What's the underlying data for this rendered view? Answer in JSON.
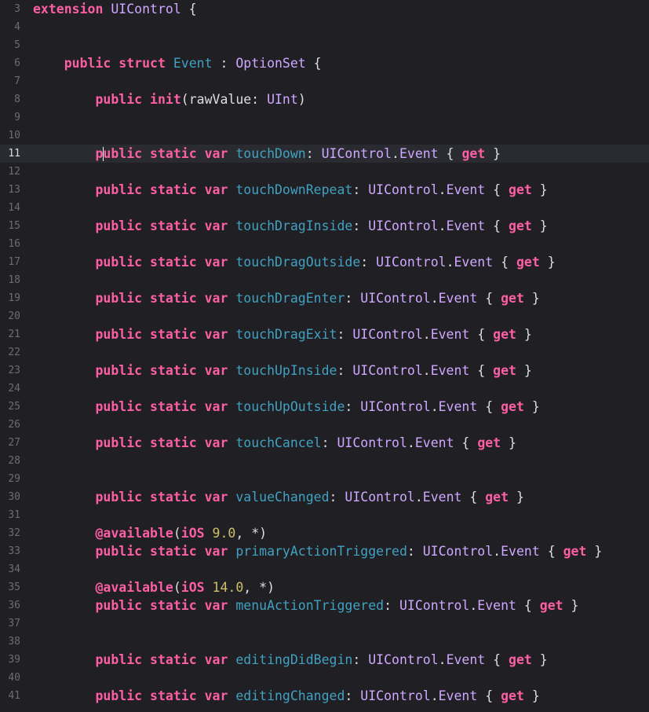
{
  "editor": {
    "colors": {
      "background": "#1f1f24",
      "current_line": "#2a2b31",
      "keyword": "#fc5fa3",
      "type": "#d0a8ff",
      "declaration": "#41a1c0",
      "number": "#d0bf69",
      "plain": "#dfdfe0",
      "line_number": "#6c6c73"
    },
    "current_line": 11,
    "lines": [
      {
        "n": "3",
        "tokens": [
          [
            "kw",
            "extension"
          ],
          [
            "plain",
            " "
          ],
          [
            "type",
            "UIControl"
          ],
          [
            "plain",
            " {"
          ]
        ]
      },
      {
        "n": "4",
        "tokens": []
      },
      {
        "n": "5",
        "tokens": []
      },
      {
        "n": "6",
        "tokens": [
          [
            "plain",
            "    "
          ],
          [
            "kw",
            "public"
          ],
          [
            "plain",
            " "
          ],
          [
            "kw",
            "struct"
          ],
          [
            "plain",
            " "
          ],
          [
            "decl",
            "Event"
          ],
          [
            "plain",
            " : "
          ],
          [
            "type",
            "OptionSet"
          ],
          [
            "plain",
            " {"
          ]
        ]
      },
      {
        "n": "7",
        "tokens": []
      },
      {
        "n": "8",
        "tokens": [
          [
            "plain",
            "        "
          ],
          [
            "kw",
            "public"
          ],
          [
            "plain",
            " "
          ],
          [
            "kw",
            "init"
          ],
          [
            "plain",
            "(rawValue: "
          ],
          [
            "type",
            "UInt"
          ],
          [
            "plain",
            ")"
          ]
        ]
      },
      {
        "n": "9",
        "tokens": []
      },
      {
        "n": "10",
        "tokens": []
      },
      {
        "n": "11",
        "tokens": [
          [
            "plain",
            "        "
          ],
          [
            "kw",
            "public"
          ],
          [
            "plain",
            " "
          ],
          [
            "kw",
            "static"
          ],
          [
            "plain",
            " "
          ],
          [
            "kw",
            "var"
          ],
          [
            "plain",
            " "
          ],
          [
            "decl",
            "touchDown"
          ],
          [
            "plain",
            ": "
          ],
          [
            "type",
            "UIControl"
          ],
          [
            "plain",
            "."
          ],
          [
            "type",
            "Event"
          ],
          [
            "plain",
            " { "
          ],
          [
            "kw",
            "get"
          ],
          [
            "plain",
            " }"
          ]
        ]
      },
      {
        "n": "12",
        "tokens": []
      },
      {
        "n": "13",
        "tokens": [
          [
            "plain",
            "        "
          ],
          [
            "kw",
            "public"
          ],
          [
            "plain",
            " "
          ],
          [
            "kw",
            "static"
          ],
          [
            "plain",
            " "
          ],
          [
            "kw",
            "var"
          ],
          [
            "plain",
            " "
          ],
          [
            "decl",
            "touchDownRepeat"
          ],
          [
            "plain",
            ": "
          ],
          [
            "type",
            "UIControl"
          ],
          [
            "plain",
            "."
          ],
          [
            "type",
            "Event"
          ],
          [
            "plain",
            " { "
          ],
          [
            "kw",
            "get"
          ],
          [
            "plain",
            " }"
          ]
        ]
      },
      {
        "n": "14",
        "tokens": []
      },
      {
        "n": "15",
        "tokens": [
          [
            "plain",
            "        "
          ],
          [
            "kw",
            "public"
          ],
          [
            "plain",
            " "
          ],
          [
            "kw",
            "static"
          ],
          [
            "plain",
            " "
          ],
          [
            "kw",
            "var"
          ],
          [
            "plain",
            " "
          ],
          [
            "decl",
            "touchDragInside"
          ],
          [
            "plain",
            ": "
          ],
          [
            "type",
            "UIControl"
          ],
          [
            "plain",
            "."
          ],
          [
            "type",
            "Event"
          ],
          [
            "plain",
            " { "
          ],
          [
            "kw",
            "get"
          ],
          [
            "plain",
            " }"
          ]
        ]
      },
      {
        "n": "16",
        "tokens": []
      },
      {
        "n": "17",
        "tokens": [
          [
            "plain",
            "        "
          ],
          [
            "kw",
            "public"
          ],
          [
            "plain",
            " "
          ],
          [
            "kw",
            "static"
          ],
          [
            "plain",
            " "
          ],
          [
            "kw",
            "var"
          ],
          [
            "plain",
            " "
          ],
          [
            "decl",
            "touchDragOutside"
          ],
          [
            "plain",
            ": "
          ],
          [
            "type",
            "UIControl"
          ],
          [
            "plain",
            "."
          ],
          [
            "type",
            "Event"
          ],
          [
            "plain",
            " { "
          ],
          [
            "kw",
            "get"
          ],
          [
            "plain",
            " }"
          ]
        ]
      },
      {
        "n": "18",
        "tokens": []
      },
      {
        "n": "19",
        "tokens": [
          [
            "plain",
            "        "
          ],
          [
            "kw",
            "public"
          ],
          [
            "plain",
            " "
          ],
          [
            "kw",
            "static"
          ],
          [
            "plain",
            " "
          ],
          [
            "kw",
            "var"
          ],
          [
            "plain",
            " "
          ],
          [
            "decl",
            "touchDragEnter"
          ],
          [
            "plain",
            ": "
          ],
          [
            "type",
            "UIControl"
          ],
          [
            "plain",
            "."
          ],
          [
            "type",
            "Event"
          ],
          [
            "plain",
            " { "
          ],
          [
            "kw",
            "get"
          ],
          [
            "plain",
            " }"
          ]
        ]
      },
      {
        "n": "20",
        "tokens": []
      },
      {
        "n": "21",
        "tokens": [
          [
            "plain",
            "        "
          ],
          [
            "kw",
            "public"
          ],
          [
            "plain",
            " "
          ],
          [
            "kw",
            "static"
          ],
          [
            "plain",
            " "
          ],
          [
            "kw",
            "var"
          ],
          [
            "plain",
            " "
          ],
          [
            "decl",
            "touchDragExit"
          ],
          [
            "plain",
            ": "
          ],
          [
            "type",
            "UIControl"
          ],
          [
            "plain",
            "."
          ],
          [
            "type",
            "Event"
          ],
          [
            "plain",
            " { "
          ],
          [
            "kw",
            "get"
          ],
          [
            "plain",
            " }"
          ]
        ]
      },
      {
        "n": "22",
        "tokens": []
      },
      {
        "n": "23",
        "tokens": [
          [
            "plain",
            "        "
          ],
          [
            "kw",
            "public"
          ],
          [
            "plain",
            " "
          ],
          [
            "kw",
            "static"
          ],
          [
            "plain",
            " "
          ],
          [
            "kw",
            "var"
          ],
          [
            "plain",
            " "
          ],
          [
            "decl",
            "touchUpInside"
          ],
          [
            "plain",
            ": "
          ],
          [
            "type",
            "UIControl"
          ],
          [
            "plain",
            "."
          ],
          [
            "type",
            "Event"
          ],
          [
            "plain",
            " { "
          ],
          [
            "kw",
            "get"
          ],
          [
            "plain",
            " }"
          ]
        ]
      },
      {
        "n": "24",
        "tokens": []
      },
      {
        "n": "25",
        "tokens": [
          [
            "plain",
            "        "
          ],
          [
            "kw",
            "public"
          ],
          [
            "plain",
            " "
          ],
          [
            "kw",
            "static"
          ],
          [
            "plain",
            " "
          ],
          [
            "kw",
            "var"
          ],
          [
            "plain",
            " "
          ],
          [
            "decl",
            "touchUpOutside"
          ],
          [
            "plain",
            ": "
          ],
          [
            "type",
            "UIControl"
          ],
          [
            "plain",
            "."
          ],
          [
            "type",
            "Event"
          ],
          [
            "plain",
            " { "
          ],
          [
            "kw",
            "get"
          ],
          [
            "plain",
            " }"
          ]
        ]
      },
      {
        "n": "26",
        "tokens": []
      },
      {
        "n": "27",
        "tokens": [
          [
            "plain",
            "        "
          ],
          [
            "kw",
            "public"
          ],
          [
            "plain",
            " "
          ],
          [
            "kw",
            "static"
          ],
          [
            "plain",
            " "
          ],
          [
            "kw",
            "var"
          ],
          [
            "plain",
            " "
          ],
          [
            "decl",
            "touchCancel"
          ],
          [
            "plain",
            ": "
          ],
          [
            "type",
            "UIControl"
          ],
          [
            "plain",
            "."
          ],
          [
            "type",
            "Event"
          ],
          [
            "plain",
            " { "
          ],
          [
            "kw",
            "get"
          ],
          [
            "plain",
            " }"
          ]
        ]
      },
      {
        "n": "28",
        "tokens": []
      },
      {
        "n": "29",
        "tokens": []
      },
      {
        "n": "30",
        "tokens": [
          [
            "plain",
            "        "
          ],
          [
            "kw",
            "public"
          ],
          [
            "plain",
            " "
          ],
          [
            "kw",
            "static"
          ],
          [
            "plain",
            " "
          ],
          [
            "kw",
            "var"
          ],
          [
            "plain",
            " "
          ],
          [
            "decl",
            "valueChanged"
          ],
          [
            "plain",
            ": "
          ],
          [
            "type",
            "UIControl"
          ],
          [
            "plain",
            "."
          ],
          [
            "type",
            "Event"
          ],
          [
            "plain",
            " { "
          ],
          [
            "kw",
            "get"
          ],
          [
            "plain",
            " }"
          ]
        ]
      },
      {
        "n": "31",
        "tokens": []
      },
      {
        "n": "32",
        "tokens": [
          [
            "plain",
            "        "
          ],
          [
            "kw",
            "@available"
          ],
          [
            "plain",
            "("
          ],
          [
            "kw",
            "iOS"
          ],
          [
            "plain",
            " "
          ],
          [
            "num",
            "9.0"
          ],
          [
            "plain",
            ", *)"
          ]
        ]
      },
      {
        "n": "33",
        "tokens": [
          [
            "plain",
            "        "
          ],
          [
            "kw",
            "public"
          ],
          [
            "plain",
            " "
          ],
          [
            "kw",
            "static"
          ],
          [
            "plain",
            " "
          ],
          [
            "kw",
            "var"
          ],
          [
            "plain",
            " "
          ],
          [
            "decl",
            "primaryActionTriggered"
          ],
          [
            "plain",
            ": "
          ],
          [
            "type",
            "UIControl"
          ],
          [
            "plain",
            "."
          ],
          [
            "type",
            "Event"
          ],
          [
            "plain",
            " { "
          ],
          [
            "kw",
            "get"
          ],
          [
            "plain",
            " }"
          ]
        ]
      },
      {
        "n": "34",
        "tokens": []
      },
      {
        "n": "35",
        "tokens": [
          [
            "plain",
            "        "
          ],
          [
            "kw",
            "@available"
          ],
          [
            "plain",
            "("
          ],
          [
            "kw",
            "iOS"
          ],
          [
            "plain",
            " "
          ],
          [
            "num",
            "14.0"
          ],
          [
            "plain",
            ", *)"
          ]
        ]
      },
      {
        "n": "36",
        "tokens": [
          [
            "plain",
            "        "
          ],
          [
            "kw",
            "public"
          ],
          [
            "plain",
            " "
          ],
          [
            "kw",
            "static"
          ],
          [
            "plain",
            " "
          ],
          [
            "kw",
            "var"
          ],
          [
            "plain",
            " "
          ],
          [
            "decl",
            "menuActionTriggered"
          ],
          [
            "plain",
            ": "
          ],
          [
            "type",
            "UIControl"
          ],
          [
            "plain",
            "."
          ],
          [
            "type",
            "Event"
          ],
          [
            "plain",
            " { "
          ],
          [
            "kw",
            "get"
          ],
          [
            "plain",
            " }"
          ]
        ]
      },
      {
        "n": "37",
        "tokens": []
      },
      {
        "n": "38",
        "tokens": []
      },
      {
        "n": "39",
        "tokens": [
          [
            "plain",
            "        "
          ],
          [
            "kw",
            "public"
          ],
          [
            "plain",
            " "
          ],
          [
            "kw",
            "static"
          ],
          [
            "plain",
            " "
          ],
          [
            "kw",
            "var"
          ],
          [
            "plain",
            " "
          ],
          [
            "decl",
            "editingDidBegin"
          ],
          [
            "plain",
            ": "
          ],
          [
            "type",
            "UIControl"
          ],
          [
            "plain",
            "."
          ],
          [
            "type",
            "Event"
          ],
          [
            "plain",
            " { "
          ],
          [
            "kw",
            "get"
          ],
          [
            "plain",
            " }"
          ]
        ]
      },
      {
        "n": "40",
        "tokens": []
      },
      {
        "n": "41",
        "tokens": [
          [
            "plain",
            "        "
          ],
          [
            "kw",
            "public"
          ],
          [
            "plain",
            " "
          ],
          [
            "kw",
            "static"
          ],
          [
            "plain",
            " "
          ],
          [
            "kw",
            "var"
          ],
          [
            "plain",
            " "
          ],
          [
            "decl",
            "editingChanged"
          ],
          [
            "plain",
            ": "
          ],
          [
            "type",
            "UIControl"
          ],
          [
            "plain",
            "."
          ],
          [
            "type",
            "Event"
          ],
          [
            "plain",
            " { "
          ],
          [
            "kw",
            "get"
          ],
          [
            "plain",
            " }"
          ]
        ]
      }
    ]
  }
}
